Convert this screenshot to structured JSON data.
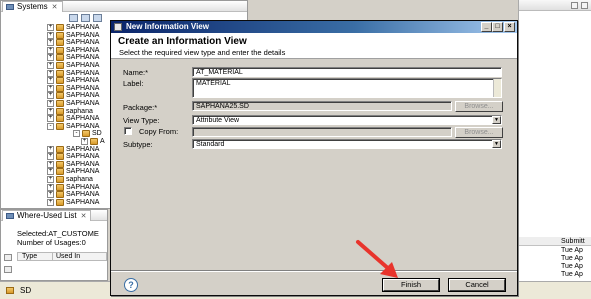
{
  "systems_view": {
    "tab_label": "Systems",
    "tree_rows": [
      {
        "label": "SAPHANA",
        "state": "+"
      },
      {
        "label": "SAPHANA",
        "state": "+"
      },
      {
        "label": "SAPHANA",
        "state": "+"
      },
      {
        "label": "SAPHANA",
        "state": "+"
      },
      {
        "label": "SAPHANA",
        "state": "+"
      },
      {
        "label": "SAPHANA",
        "state": "+"
      },
      {
        "label": "SAPHANA",
        "state": "+"
      },
      {
        "label": "SAPHANA",
        "state": "+"
      },
      {
        "label": "SAPHANA",
        "state": "+"
      },
      {
        "label": "SAPHANA",
        "state": "+"
      },
      {
        "label": "SAPHANA",
        "state": "+"
      },
      {
        "label": "saphana",
        "state": "+"
      },
      {
        "label": "SAPHANA",
        "state": "+"
      },
      {
        "label": "SAPHANA",
        "state": "-"
      },
      {
        "label": "SD",
        "state": "-"
      },
      {
        "label": "A",
        "state": "+"
      },
      {
        "label": "SAPHANA",
        "state": "+"
      },
      {
        "label": "SAPHANA",
        "state": "+"
      },
      {
        "label": "SAPHANA",
        "state": "+"
      },
      {
        "label": "SAPHANA",
        "state": "+"
      },
      {
        "label": "saphana",
        "state": "+"
      },
      {
        "label": "SAPHANA",
        "state": "+"
      },
      {
        "label": "SAPHANA",
        "state": "+"
      },
      {
        "label": "SAPHANA",
        "state": "+"
      }
    ]
  },
  "where_used": {
    "tab_label": "Where-Used List",
    "selected": "Selected:AT_CUSTOME",
    "usages": "Number of Usages:0",
    "columns": [
      "Type",
      "Used In"
    ]
  },
  "right_view": {
    "column_header": "Submitt",
    "cells": [
      "Tue Ap",
      "Tue Ap",
      "Tue Ap",
      "Tue Ap"
    ]
  },
  "status_bar": {
    "label": "SD"
  },
  "dialog": {
    "title": "New Information View",
    "header_title": "Create an Information View",
    "header_subtitle": "Select the required view type and enter the details",
    "name_label": "Name:*",
    "name_value": "AT_MATERIAL",
    "label_label": "Label:",
    "label_value": "MATERIAL",
    "package_label": "Package:*",
    "package_value": "SAPHANA25.SD",
    "browse_label": "Browse...",
    "view_type_label": "View Type:",
    "view_type_value": "Attribute View",
    "copy_from_label": "Copy From:",
    "subtype_label": "Subtype:",
    "subtype_value": "Standard",
    "help_icon": "?",
    "finish_label": "Finish",
    "cancel_label": "Cancel"
  },
  "colors": {
    "titlebar_start": "#0a246a",
    "titlebar_end": "#a6caf0",
    "annotation_arrow": "#e8342c"
  }
}
